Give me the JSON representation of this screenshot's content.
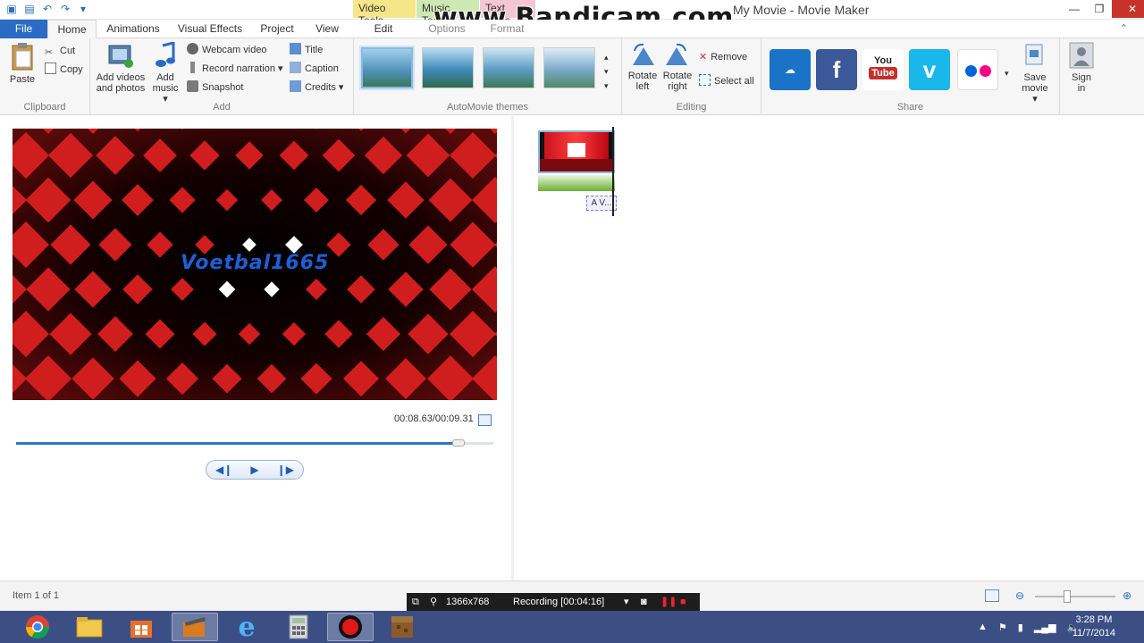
{
  "window": {
    "title": "My Movie - Movie Maker",
    "contextual_tabs": [
      "Video Tools",
      "Music Tools",
      "Text Tools"
    ]
  },
  "watermark": "www.Bandicam.com",
  "ribbon_tabs": [
    "File",
    "Home",
    "Animations",
    "Visual Effects",
    "Project",
    "View",
    "Edit",
    "Options",
    "Format"
  ],
  "clipboard": {
    "label": "Clipboard",
    "paste": "Paste",
    "cut": "Cut",
    "copy": "Copy"
  },
  "add": {
    "label": "Add",
    "add_videos_line1": "Add videos",
    "add_videos_line2": "and photos",
    "add_music_line1": "Add",
    "add_music_line2": "music",
    "webcam": "Webcam video",
    "narration": "Record narration",
    "snapshot": "Snapshot",
    "title": "Title",
    "caption": "Caption",
    "credits": "Credits"
  },
  "themes": {
    "label": "AutoMovie themes"
  },
  "editing": {
    "label": "Editing",
    "rotate_left_1": "Rotate",
    "rotate_left_2": "left",
    "rotate_right_1": "Rotate",
    "rotate_right_2": "right",
    "remove": "Remove",
    "select_all": "Select all"
  },
  "share": {
    "label": "Share",
    "save_movie_1": "Save",
    "save_movie_2": "movie",
    "sign_in_1": "Sign",
    "sign_in_2": "in",
    "services": [
      "onedrive-icon",
      "facebook-icon",
      "youtube-icon",
      "vimeo-icon",
      "flickr-icon"
    ]
  },
  "preview": {
    "video_title": "Voetbal1665",
    "timecode": "00:08.63/00:09.31",
    "progress": 0.927
  },
  "storyboard": {
    "text_clip": "A V..."
  },
  "status": {
    "item_count": "Item 1 of 1"
  },
  "recording": {
    "resolution": "1366x768",
    "status": "Recording [00:04:16]"
  },
  "taskbar": {
    "apps": [
      "chrome-icon",
      "file-explorer-icon",
      "store-icon",
      "movie-maker-icon",
      "internet-explorer-icon",
      "calculator-icon",
      "bandicam-icon",
      "minecraft-icon"
    ],
    "time": "3:28 PM",
    "date": "11/7/2014"
  },
  "colors": {
    "accent": "#2a6cc4",
    "video_red": "#c0101a",
    "taskbar": "#3b4f85"
  }
}
